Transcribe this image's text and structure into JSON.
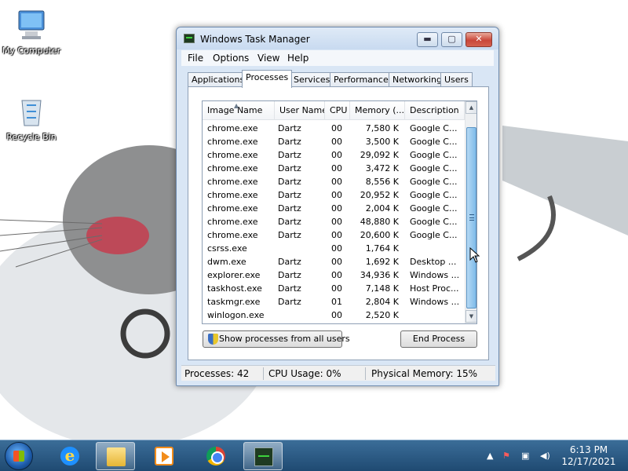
{
  "desktop": {
    "icons": [
      {
        "label": "My Computer",
        "icon": "computer-icon"
      },
      {
        "label": "Recycle Bin",
        "icon": "recycle-bin-icon"
      }
    ]
  },
  "window": {
    "title": "Windows Task Manager",
    "controls": {
      "minimize": "▬",
      "maximize": "▢",
      "close": "✕"
    }
  },
  "menu": [
    "File",
    "Options",
    "View",
    "Help"
  ],
  "tabs": [
    "Applications",
    "Processes",
    "Services",
    "Performance",
    "Networking",
    "Users"
  ],
  "active_tab": "Processes",
  "table": {
    "columns": [
      "Image Name",
      "User Name",
      "CPU",
      "Memory (...",
      "Description"
    ],
    "rows": [
      [
        "chrome.exe",
        "Dartz",
        "00",
        "7,580 K",
        "Google C..."
      ],
      [
        "chrome.exe",
        "Dartz",
        "00",
        "3,500 K",
        "Google C..."
      ],
      [
        "chrome.exe",
        "Dartz",
        "00",
        "29,092 K",
        "Google C..."
      ],
      [
        "chrome.exe",
        "Dartz",
        "00",
        "3,472 K",
        "Google C..."
      ],
      [
        "chrome.exe",
        "Dartz",
        "00",
        "8,556 K",
        "Google C..."
      ],
      [
        "chrome.exe",
        "Dartz",
        "00",
        "20,952 K",
        "Google C..."
      ],
      [
        "chrome.exe",
        "Dartz",
        "00",
        "2,004 K",
        "Google C..."
      ],
      [
        "chrome.exe",
        "Dartz",
        "00",
        "48,880 K",
        "Google C..."
      ],
      [
        "chrome.exe",
        "Dartz",
        "00",
        "20,600 K",
        "Google C..."
      ],
      [
        "csrss.exe",
        "",
        "00",
        "1,764 K",
        ""
      ],
      [
        "dwm.exe",
        "Dartz",
        "00",
        "1,692 K",
        "Desktop ..."
      ],
      [
        "explorer.exe",
        "Dartz",
        "00",
        "34,936 K",
        "Windows ..."
      ],
      [
        "taskhost.exe",
        "Dartz",
        "00",
        "7,148 K",
        "Host Proc..."
      ],
      [
        "taskmgr.exe",
        "Dartz",
        "01",
        "2,804 K",
        "Windows ..."
      ],
      [
        "winlogon.exe",
        "",
        "00",
        "2,520 K",
        ""
      ]
    ]
  },
  "buttons": {
    "show_all": "Show processes from all users",
    "end_process": "End Process"
  },
  "status": {
    "processes": "Processes: 42",
    "cpu": "CPU Usage: 0%",
    "memory": "Physical Memory: 15%"
  },
  "taskbar": {
    "pinned": [
      "internet-explorer-icon",
      "folder-icon",
      "media-player-icon",
      "chrome-icon",
      "task-manager-icon"
    ],
    "time": "6:13 PM",
    "date": "12/17/2021"
  },
  "colors": {
    "window_frame": "#d9e6f5",
    "taskbar": "#2b5a86",
    "scroll_thumb": "#7fbbe9"
  }
}
